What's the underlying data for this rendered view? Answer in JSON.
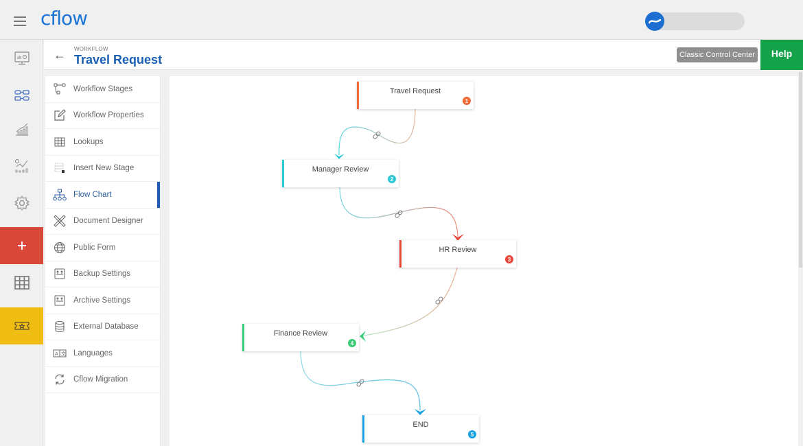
{
  "app": {
    "logo_text": "cflow"
  },
  "header": {
    "breadcrumb": "WORKFLOW",
    "title": "Travel Request",
    "classic_button": "Classic Control Center",
    "help_button": "Help"
  },
  "rail": [
    {
      "name": "dashboard-icon"
    },
    {
      "name": "workflow-icon"
    },
    {
      "name": "reports-icon"
    },
    {
      "name": "analytics-icon"
    },
    {
      "name": "settings-icon"
    },
    {
      "name": "add-icon"
    },
    {
      "name": "grid-icon"
    },
    {
      "name": "ticket-icon"
    }
  ],
  "menu": [
    {
      "label": "Workflow Stages",
      "icon": "workflow-stages-icon"
    },
    {
      "label": "Workflow Properties",
      "icon": "edit-icon"
    },
    {
      "label": "Lookups",
      "icon": "table-icon"
    },
    {
      "label": "Insert New Stage",
      "icon": "insert-stage-icon"
    },
    {
      "label": "Flow Chart",
      "icon": "flow-chart-icon",
      "active": true
    },
    {
      "label": "Document Designer",
      "icon": "design-tools-icon"
    },
    {
      "label": "Public Form",
      "icon": "globe-icon"
    },
    {
      "label": "Backup Settings",
      "icon": "backup-icon"
    },
    {
      "label": "Archive Settings",
      "icon": "archive-icon"
    },
    {
      "label": "External Database",
      "icon": "database-icon"
    },
    {
      "label": "Languages",
      "icon": "languages-icon"
    },
    {
      "label": "Cflow Migration",
      "icon": "refresh-icon"
    }
  ],
  "flow": {
    "nodes": [
      {
        "label": "Travel Request",
        "number": "1",
        "color": "#f06a35"
      },
      {
        "label": "Manager Review",
        "number": "2",
        "color": "#2ec8d6"
      },
      {
        "label": "HR Review",
        "number": "3",
        "color": "#e8463a"
      },
      {
        "label": "Finance Review",
        "number": "4",
        "color": "#3ccb78"
      },
      {
        "label": "END",
        "number": "5",
        "color": "#1aa3e0"
      }
    ]
  },
  "colors": {
    "brand": "#1c74d4",
    "title": "#1a5fb4",
    "help": "#14a24b",
    "add": "#d9473b",
    "ticket": "#f0be12"
  }
}
